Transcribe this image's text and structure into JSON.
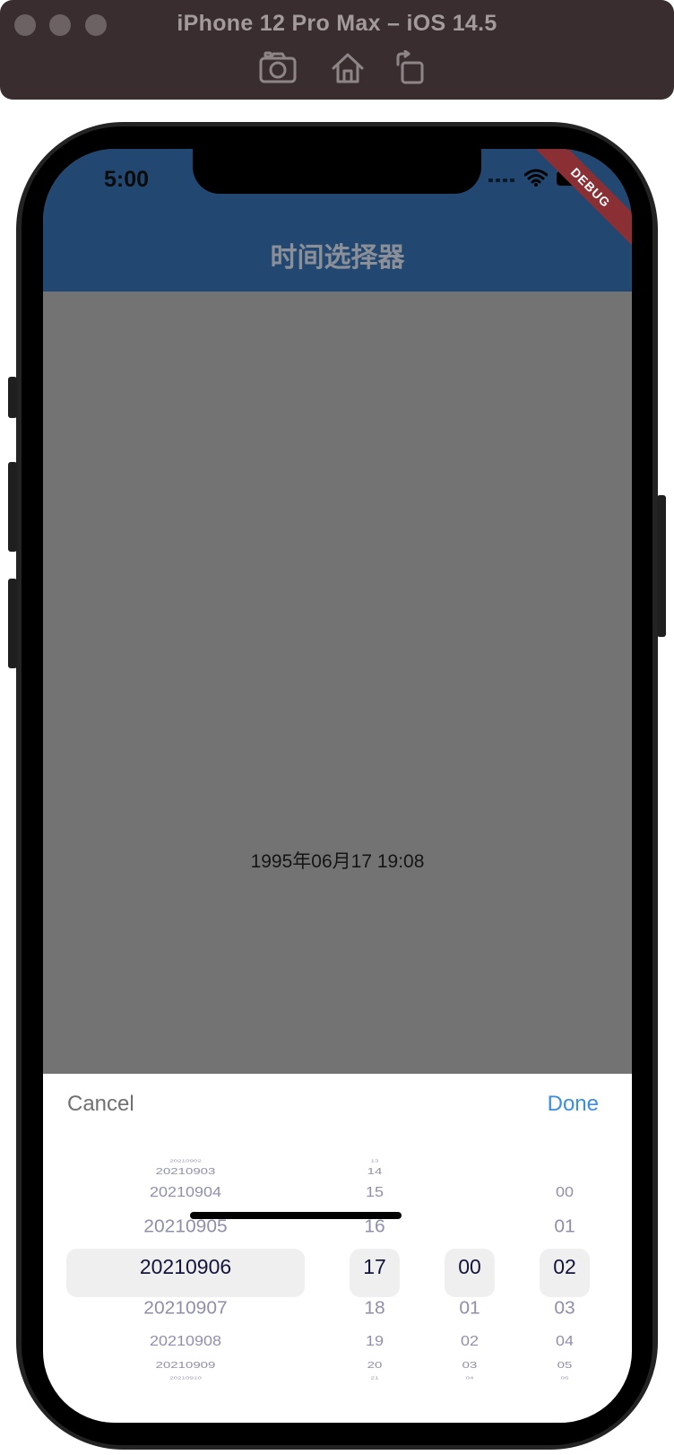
{
  "simulator": {
    "title": "iPhone 12 Pro Max – iOS 14.5",
    "toolbar_icons": [
      "screenshot-icon",
      "home-icon",
      "rotate-icon"
    ]
  },
  "status_bar": {
    "time": "5:00",
    "debug_banner": "DEBUG"
  },
  "app_bar": {
    "title": "时间选择器",
    "color": "#224872"
  },
  "body": {
    "selected_datetime": "1995年06月17 19:08",
    "background": "#737373"
  },
  "picker": {
    "cancel_label": "Cancel",
    "done_label": "Done",
    "accent": "#3b8ee0",
    "columns": {
      "date": [
        "20210902",
        "20210903",
        "20210904",
        "20210905",
        "20210906",
        "20210907",
        "20210908",
        "20210909",
        "20210910"
      ],
      "hour": [
        "13",
        "14",
        "15",
        "16",
        "17",
        "18",
        "19",
        "20",
        "21"
      ],
      "minute": [
        "",
        "",
        "",
        "",
        "00",
        "01",
        "02",
        "03",
        "04"
      ],
      "second": [
        "",
        "",
        "00",
        "01",
        "02",
        "03",
        "04",
        "05",
        "06"
      ]
    },
    "selected": {
      "date": "20210906",
      "hour": "17",
      "minute": "00",
      "second": "02"
    }
  }
}
